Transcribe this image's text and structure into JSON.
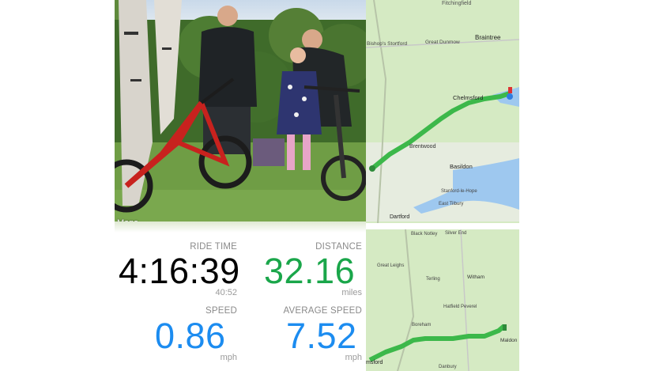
{
  "photo": {
    "watermark": "Maps"
  },
  "stats": {
    "ride_time": {
      "label": "RIDE TIME",
      "value": "4:16:39",
      "sub": "40:52",
      "color": "#000000"
    },
    "distance": {
      "label": "DISTANCE",
      "value": "32.16",
      "unit": "miles",
      "color": "#1aa64a"
    },
    "speed": {
      "label": "SPEED",
      "value": "0.86",
      "unit": "mph",
      "color": "#1c8cf0"
    },
    "avg_speed": {
      "label": "AVERAGE SPEED",
      "value": "7.52",
      "unit": "mph",
      "color": "#1c8cf0"
    }
  },
  "map": {
    "places": {
      "p1": "Bishop's Stortford",
      "p2": "Great Dunmow",
      "p3": "Braintree",
      "p4": "Chelmsford",
      "p5": "Brentwood",
      "p6": "Basildon",
      "p7": "Stanford-le-Hope",
      "p8": "East Tilbury",
      "p9": "Dartford",
      "p10": "Silver End",
      "p11": "Black Notley",
      "p12": "Great Leighs",
      "p13": "Terling",
      "p14": "Witham",
      "p15": "Hatfield Peverel",
      "p16": "Boreham",
      "p17": "Maldon",
      "p18": "Danbury",
      "p19": "msford"
    },
    "route_color": "#3cb84a",
    "water_color": "#9ec8ef"
  }
}
